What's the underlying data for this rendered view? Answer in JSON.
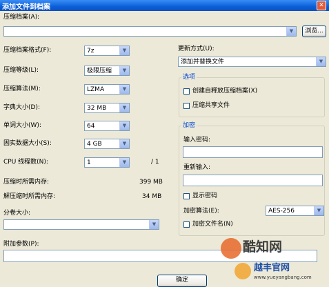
{
  "window": {
    "title": "添加文件到档案"
  },
  "archive": {
    "label": "压缩档案(A):",
    "value": "",
    "browse_label": "浏览..."
  },
  "format": {
    "label": "压缩档案格式(F):",
    "value": "7z"
  },
  "level": {
    "label": "压缩等级(L):",
    "value": "极限压缩"
  },
  "method": {
    "label": "压缩算法(M):",
    "value": "LZMA"
  },
  "dict": {
    "label": "字典大小(D):",
    "value": "32 MB"
  },
  "word": {
    "label": "单词大小(W):",
    "value": "64"
  },
  "solid": {
    "label": "固实数据大小(S):",
    "value": "4 GB"
  },
  "threads": {
    "label": "CPU 线程数(N):",
    "value": "1",
    "max": "/ 1"
  },
  "memory": {
    "compress_label": "压缩时所需内存:",
    "compress_value": "399 MB",
    "decompress_label": "解压缩时所需内存:",
    "decompress_value": "34 MB"
  },
  "volume": {
    "label": "分卷大小:",
    "value": ""
  },
  "params": {
    "label": "附加参数(P):",
    "value": ""
  },
  "update": {
    "label": "更新方式(U):",
    "value": "添加并替换文件"
  },
  "options": {
    "title": "选项",
    "sfx_label": "创建自释放压缩档案(X)",
    "shared_label": "压缩共享文件"
  },
  "encryption": {
    "title": "加密",
    "password_label": "输入密码:",
    "reenter_label": "重新输入:",
    "show_label": "显示密码",
    "method_label": "加密算法(E):",
    "method_value": "AES-256",
    "encrypt_names_label": "加密文件名(N)"
  },
  "buttons": {
    "ok_label": "确定"
  },
  "watermark": {
    "brand1": "酷知网",
    "brand2": "越丰官网",
    "url": "www.yueyangbang.com"
  }
}
